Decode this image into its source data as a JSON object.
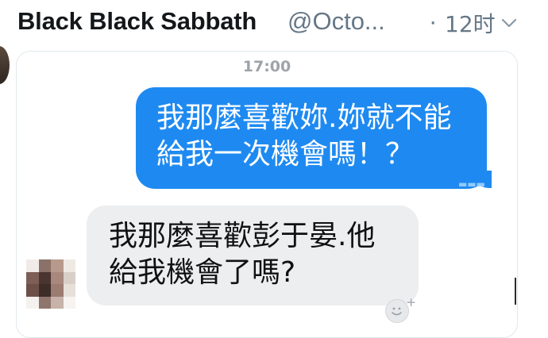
{
  "tweet": {
    "display_name": "Black Black Sabbath",
    "handle": "@Octo...",
    "separator": "·",
    "time_ago": "12时"
  },
  "chat": {
    "timestamp": "17:00",
    "outgoing": {
      "line1": "我那麼喜歡妳.妳就不能",
      "line2": "給我一次機會嗎！？"
    },
    "incoming": {
      "line1": "我那麼喜歡彭于晏.他",
      "line2": "給我機會了嗎?"
    },
    "emoji_add_symbol": "+",
    "colors": {
      "outgoing_bubble": "#1e8af1",
      "incoming_bubble": "#eceef0"
    }
  },
  "icons": {
    "more": "chevron-down-icon",
    "add_reaction": "emoji-add-icon"
  }
}
